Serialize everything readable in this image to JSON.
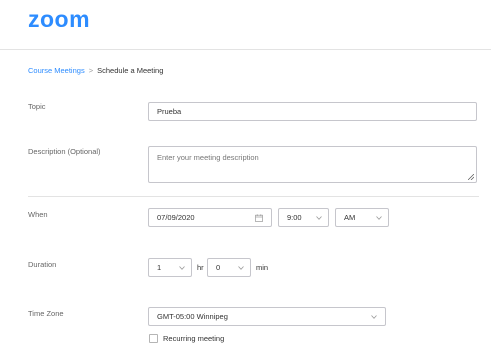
{
  "header": {
    "logo_text": "zoom"
  },
  "breadcrumb": {
    "parent": "Course Meetings",
    "separator": ">",
    "current": "Schedule a Meeting"
  },
  "form": {
    "topic": {
      "label": "Topic",
      "value": "Prueba"
    },
    "description": {
      "label": "Description (Optional)",
      "placeholder": "Enter your meeting description"
    },
    "when": {
      "label": "When",
      "date": "07/09/2020",
      "time": "9:00",
      "ampm": "AM"
    },
    "duration": {
      "label": "Duration",
      "hours": "1",
      "hours_unit": "hr",
      "minutes": "0",
      "minutes_unit": "min"
    },
    "timezone": {
      "label": "Time Zone",
      "value": "GMT-05:00 Winnipeg"
    },
    "recurring": {
      "label": "Recurring meeting",
      "checked": false
    }
  },
  "colors": {
    "brand": "#2d8cff",
    "border": "#c6c6cc",
    "label": "#666666"
  }
}
